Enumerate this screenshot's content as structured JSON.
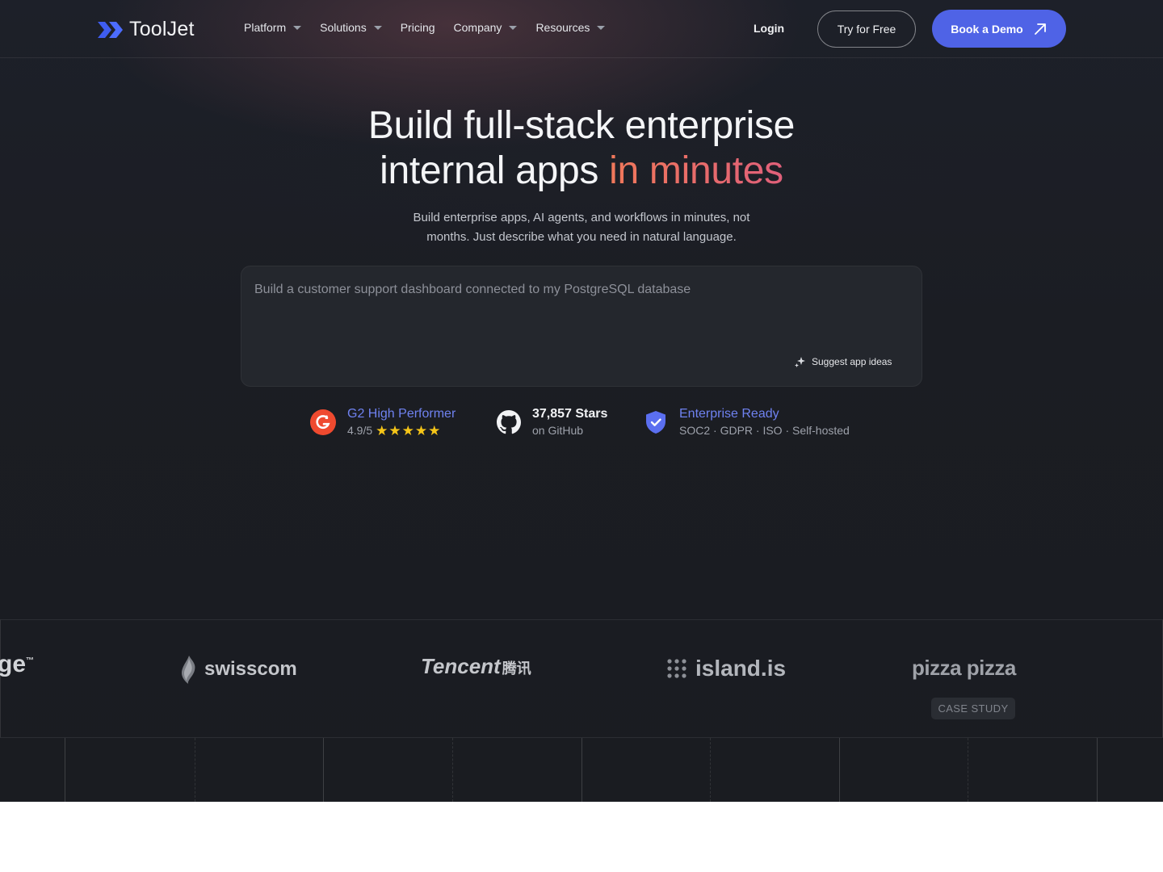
{
  "header": {
    "logo_text": "ToolJet",
    "menu": [
      {
        "label": "Platform",
        "has_dropdown": true
      },
      {
        "label": "Solutions",
        "has_dropdown": true
      },
      {
        "label": "Pricing",
        "has_dropdown": false
      },
      {
        "label": "Company",
        "has_dropdown": true
      },
      {
        "label": "Resources",
        "has_dropdown": true
      }
    ],
    "login_label": "Login",
    "try_label": "Try for Free",
    "demo_label": "Book a Demo"
  },
  "hero": {
    "title_line1": "Build full-stack enterprise",
    "title_line2_plain": "internal apps",
    "title_line2_accent": "in minutes",
    "subtitle_line1": "Build enterprise apps, AI agents, and workflows in minutes, not",
    "subtitle_line2": "months. Just describe what you need in natural language."
  },
  "prompt": {
    "placeholder": "Build a customer support dashboard connected to my PostgreSQL database",
    "suggest_label": "Suggest app ideas"
  },
  "badges": {
    "g2": {
      "title": "G2 High Performer",
      "rating": "4.9/5",
      "stars": 5
    },
    "github": {
      "title": "37,857 Stars",
      "subtitle": "on GitHub"
    },
    "enterprise": {
      "title": "Enterprise Ready",
      "subtitle": "SOC2 · GDPR · ISO · Self-hosted"
    }
  },
  "logos": {
    "partial": "ge",
    "swisscom": "swisscom",
    "tencent": "Tencent",
    "tencent_cjk": "腾讯",
    "island": "island.is",
    "pizza": "pizza pizza",
    "case_study": "CASE STUDY"
  },
  "colors": {
    "accent_blue": "#4f63e6",
    "link_blue": "#6f82f0",
    "accent_orange": "#f0785a",
    "background": "#1b1d23"
  }
}
